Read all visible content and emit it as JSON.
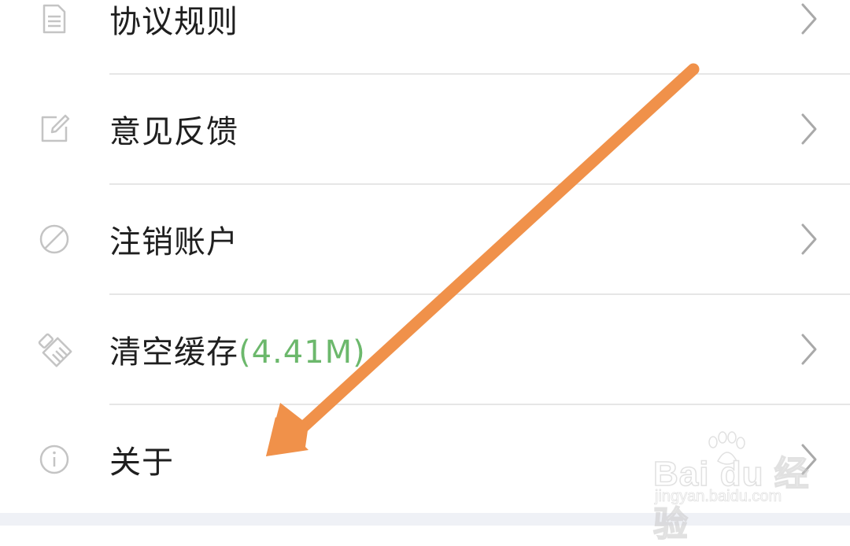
{
  "menu": {
    "items": [
      {
        "label": "协议规则",
        "icon": "document-icon"
      },
      {
        "label": "意见反馈",
        "icon": "edit-icon"
      },
      {
        "label": "注销账户",
        "icon": "prohibited-icon"
      },
      {
        "label": "清空缓存",
        "size": "(4.41M)",
        "icon": "broom-icon"
      },
      {
        "label": "关于",
        "icon": "info-icon"
      }
    ]
  },
  "colors": {
    "cache_size": "#6cb86c",
    "annotation_arrow": "#f0914a",
    "icon_gray": "#c4c4c4",
    "chevron_gray": "#a9a9a9"
  },
  "watermark": {
    "brand": "Bai du 经验",
    "url": "jingyan.baidu.com"
  }
}
